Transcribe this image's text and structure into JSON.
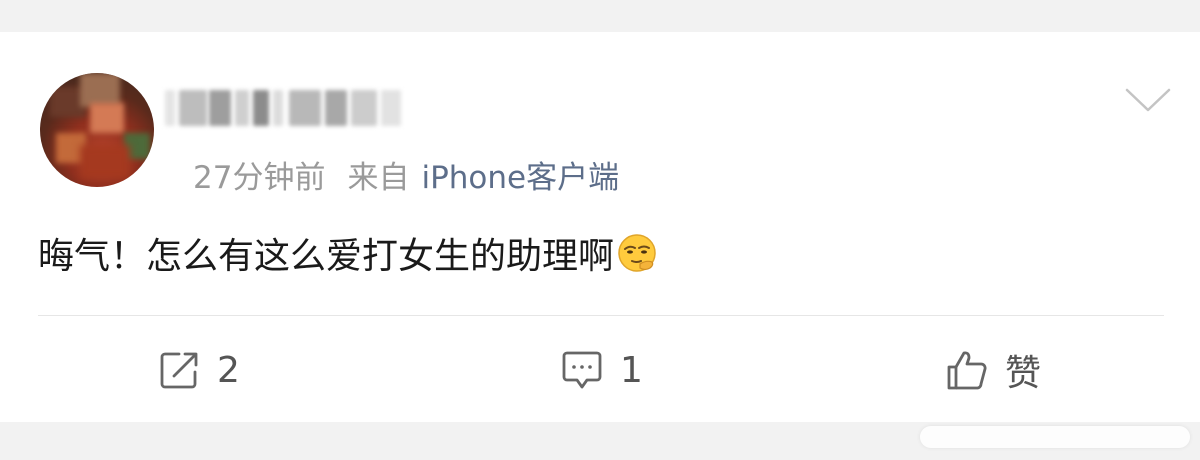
{
  "post": {
    "time": "27分钟前",
    "source_label": "来自",
    "source_link": "iPhone客户端",
    "text": "晦气！怎么有这么爱打女生的助理啊",
    "emoji": "thinking-face-emoji"
  },
  "actions": {
    "repost_count": "2",
    "comment_count": "1",
    "like_label": "赞"
  },
  "icons": {
    "more": "chevron-down-icon",
    "repost": "repost-icon",
    "comment": "comment-icon",
    "like": "thumbs-up-icon"
  },
  "colors": {
    "text": "#1a1a1a",
    "meta": "#9a9a9a",
    "link": "#5d6e8a",
    "action": "#555555"
  }
}
